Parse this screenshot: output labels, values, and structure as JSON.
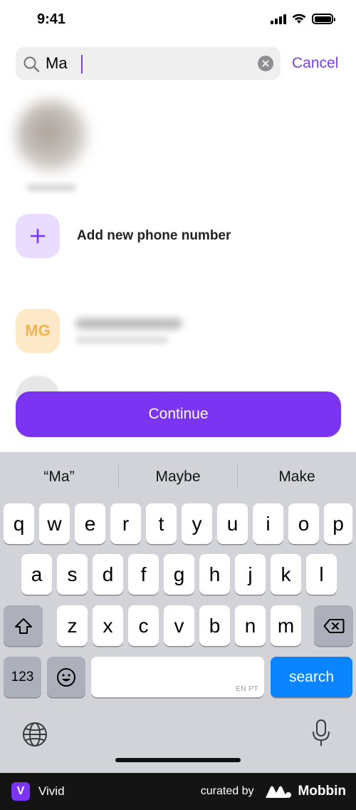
{
  "status_bar": {
    "time": "9:41"
  },
  "search": {
    "value": "Ma",
    "cancel_label": "Cancel"
  },
  "add_phone": {
    "label": "Add new phone number"
  },
  "contacts": [
    {
      "initials": "MG"
    }
  ],
  "continue_label": "Continue",
  "keyboard": {
    "suggestions": [
      "“Ma”",
      "Maybe",
      "Make"
    ],
    "row1": [
      "q",
      "w",
      "e",
      "r",
      "t",
      "y",
      "u",
      "i",
      "o",
      "p"
    ],
    "row2": [
      "a",
      "s",
      "d",
      "f",
      "g",
      "h",
      "j",
      "k",
      "l"
    ],
    "row3": [
      "z",
      "x",
      "c",
      "v",
      "b",
      "n",
      "m"
    ],
    "numbers_label": "123",
    "space_languages": "EN PT",
    "search_label": "search"
  },
  "footer": {
    "app_name": "Vivid",
    "app_logo_letter": "V",
    "curated_by": "curated by",
    "brand": "Mobbin"
  },
  "colors": {
    "accent": "#7b35f2",
    "accent_light": "#e9dcff",
    "keyboard_blue": "#0a84ff",
    "mg_avatar_bg": "#fde9c8",
    "mg_avatar_text": "#f5b24e"
  }
}
